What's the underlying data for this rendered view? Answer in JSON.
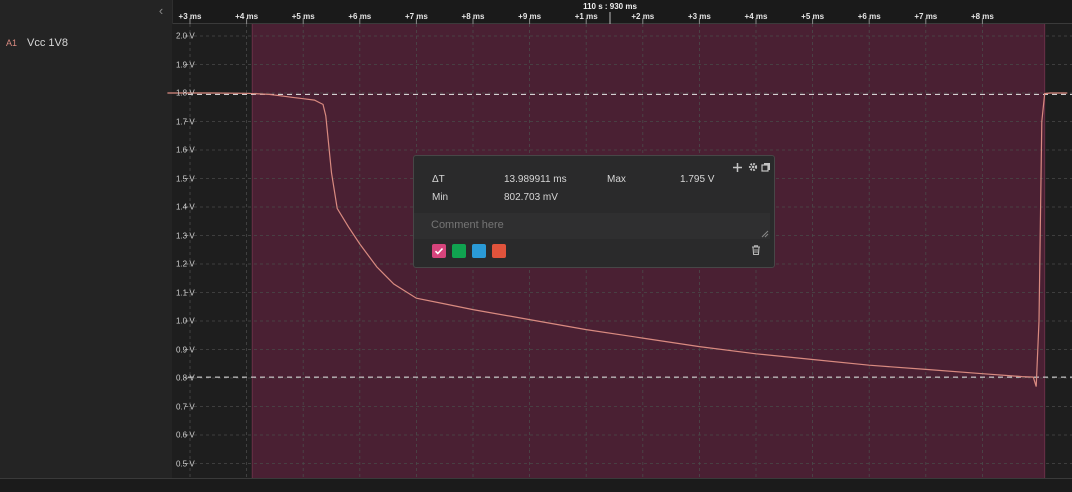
{
  "sidebar": {
    "collapse_icon": "chevron-left-icon",
    "channel": {
      "id": "A1",
      "name": "Vcc 1V8",
      "color": "#d98a80"
    }
  },
  "timeline": {
    "reference_time": "110 s : 930 ms",
    "ticks": [
      "+3 ms",
      "+4 ms",
      "+5 ms",
      "+6 ms",
      "+7 ms",
      "+8 ms",
      "+9 ms",
      "+1 ms",
      "+2 ms",
      "+3 ms",
      "+4 ms",
      "+5 ms",
      "+6 ms",
      "+7 ms",
      "+8 ms"
    ]
  },
  "y_axis": {
    "labels": [
      "2.0 V",
      "1.9 V",
      "1.8 V",
      "1.7 V",
      "1.6 V",
      "1.5 V",
      "1.4 V",
      "1.3 V",
      "1.2 V",
      "1.1 V",
      "1.0 V",
      "0.9 V",
      "0.8 V",
      "0.7 V",
      "0.6 V",
      "0.5 V"
    ]
  },
  "colors": {
    "waveform": "#d98a80",
    "selection": "#4a2033",
    "background": "#1e1e1e",
    "swatches": [
      "#d6447c",
      "#10a350",
      "#2a9ad6",
      "#e0533c"
    ]
  },
  "measurement": {
    "delta_t_label": "ΔT",
    "delta_t_value": "13.989911 ms",
    "max_label": "Max",
    "max_value": "1.795 V",
    "min_label": "Min",
    "min_value": "802.703 mV",
    "comment_placeholder": "Comment here",
    "icons": [
      "plus-icon",
      "gear-icon",
      "copy-icon",
      "trash-icon"
    ]
  },
  "chart_data": {
    "type": "line",
    "ylim": [
      0.45,
      2.03
    ],
    "y_ticks": [
      2.0,
      1.9,
      1.8,
      1.7,
      1.6,
      1.5,
      1.4,
      1.3,
      1.2,
      1.1,
      1.0,
      0.9,
      0.8,
      0.7,
      0.6,
      0.5
    ],
    "x_unit": "ms",
    "xlim": [
      2.6,
      18.5
    ],
    "selection_range": [
      4.1,
      18.1
    ],
    "markers": [
      1.795,
      0.803
    ],
    "series": [
      {
        "x": [
          2.6,
          3.4,
          4.0,
          4.4,
          4.6,
          4.8,
          5.0,
          5.2,
          5.3,
          5.35,
          5.4,
          5.5,
          5.6,
          5.8,
          6.0,
          6.3,
          6.6,
          7.0,
          7.5,
          8.0,
          9.0,
          10.0,
          11.0,
          12.0,
          13.0,
          14.0,
          15.0,
          16.0,
          17.0,
          17.7,
          17.9,
          17.95,
          18.0,
          18.05,
          18.1,
          18.2,
          18.5
        ],
        "y": [
          1.8,
          1.8,
          1.799,
          1.795,
          1.79,
          1.785,
          1.78,
          1.775,
          1.765,
          1.76,
          1.72,
          1.52,
          1.395,
          1.33,
          1.27,
          1.19,
          1.13,
          1.08,
          1.06,
          1.04,
          1.005,
          0.97,
          0.94,
          0.91,
          0.885,
          0.865,
          0.845,
          0.83,
          0.815,
          0.805,
          0.803,
          0.77,
          1.0,
          1.7,
          1.798,
          1.8,
          1.8
        ]
      }
    ]
  }
}
